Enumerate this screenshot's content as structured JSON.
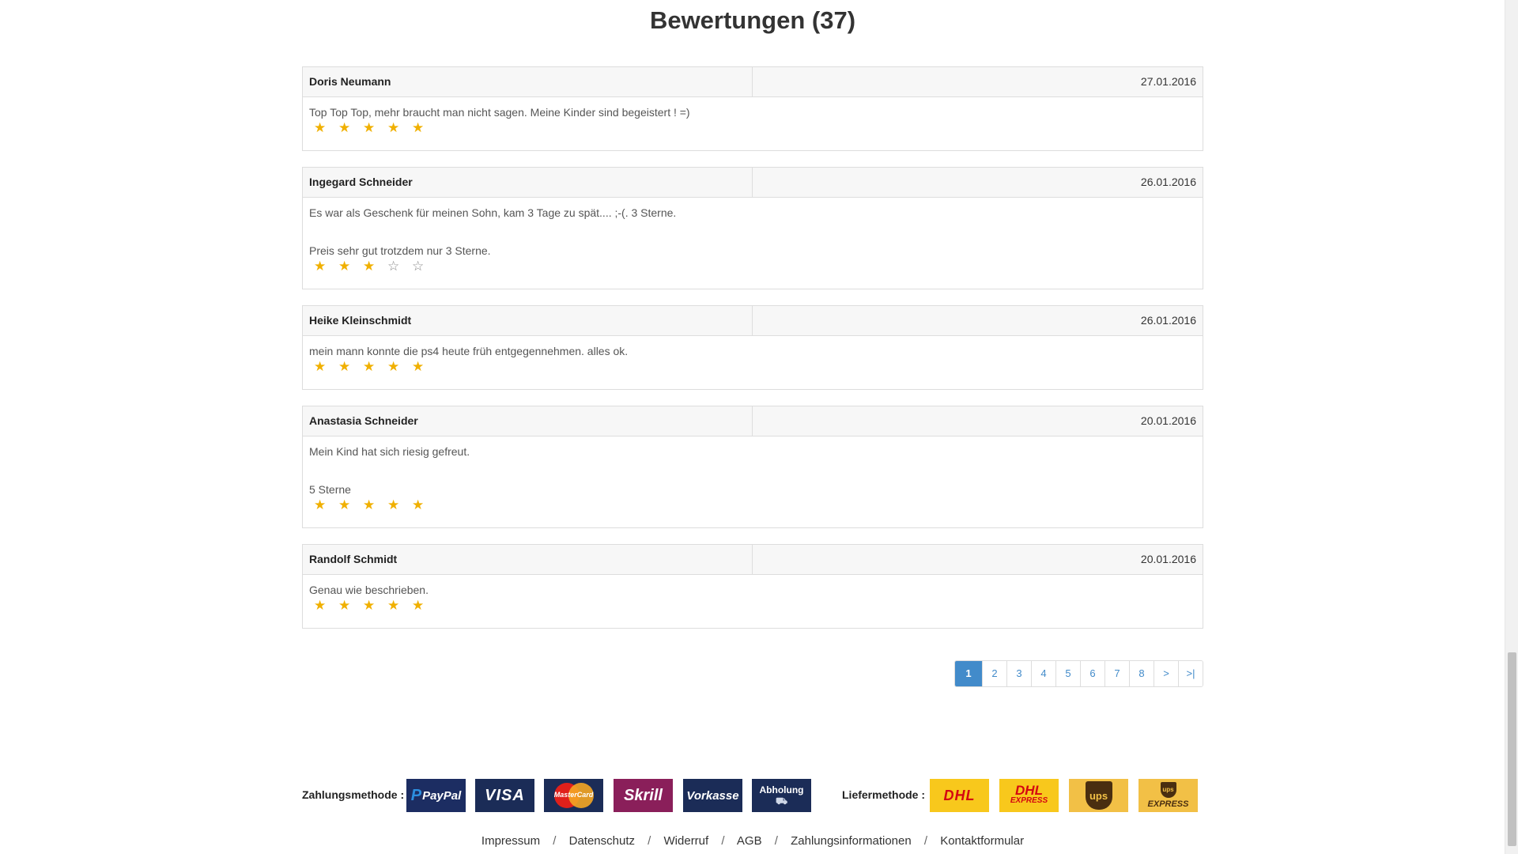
{
  "section": {
    "title": "Bewertungen (37)"
  },
  "reviews": [
    {
      "author": "Doris Neumann",
      "date": "27.01.2016",
      "text": [
        "Top Top Top, mehr braucht man nicht sagen. Meine Kinder sind begeistert ! =)"
      ],
      "rating": 5
    },
    {
      "author": "Ingegard Schneider",
      "date": "26.01.2016",
      "text": [
        "Es war als Geschenk für meinen Sohn, kam 3 Tage zu spät.... ;-(. 3 Sterne.",
        "Preis sehr gut trotzdem nur 3 Sterne."
      ],
      "rating": 3
    },
    {
      "author": "Heike Kleinschmidt",
      "date": "26.01.2016",
      "text": [
        "mein mann konnte die ps4 heute früh entgegennehmen. alles ok."
      ],
      "rating": 5
    },
    {
      "author": "Anastasia Schneider",
      "date": "20.01.2016",
      "text": [
        "Mein Kind hat sich riesig gefreut.",
        "5 Sterne"
      ],
      "rating": 5
    },
    {
      "author": "Randolf Schmidt",
      "date": "20.01.2016",
      "text": [
        "Genau wie beschrieben."
      ],
      "rating": 5
    }
  ],
  "rating_max": 5,
  "star_full_color": "#f0b000",
  "star_empty_color": "#888888",
  "pagination": {
    "active": "1",
    "pages": [
      "1",
      "2",
      "3",
      "4",
      "5",
      "6",
      "7",
      "8"
    ],
    "next": ">",
    "last": ">|"
  },
  "payment": {
    "label": "Zahlungsmethode :",
    "methods": [
      "PayPal",
      "VISA",
      "MasterCard",
      "Skrill",
      "Vorkasse",
      "Abholung"
    ]
  },
  "shipping": {
    "label": "Liefermethode :",
    "methods": [
      "DHL",
      "DHL EXPRESS",
      "ups",
      "ups EXPRESS"
    ],
    "dhl_express_line1": "DHL",
    "dhl_express_line2": "EXPRESS",
    "ups_express_line2": "EXPRESS"
  },
  "footer": {
    "links": [
      "Impressum",
      "Datenschutz",
      "Widerruf",
      "AGB",
      "Zahlungsinformationen",
      "Kontaktformular"
    ],
    "separator": "/"
  },
  "colors": {
    "accent": "#428bca",
    "paypal": "#1c2d62",
    "skrill": "#8a1f5a",
    "dhl": "#f8c81c",
    "ups": "#f2c046"
  }
}
